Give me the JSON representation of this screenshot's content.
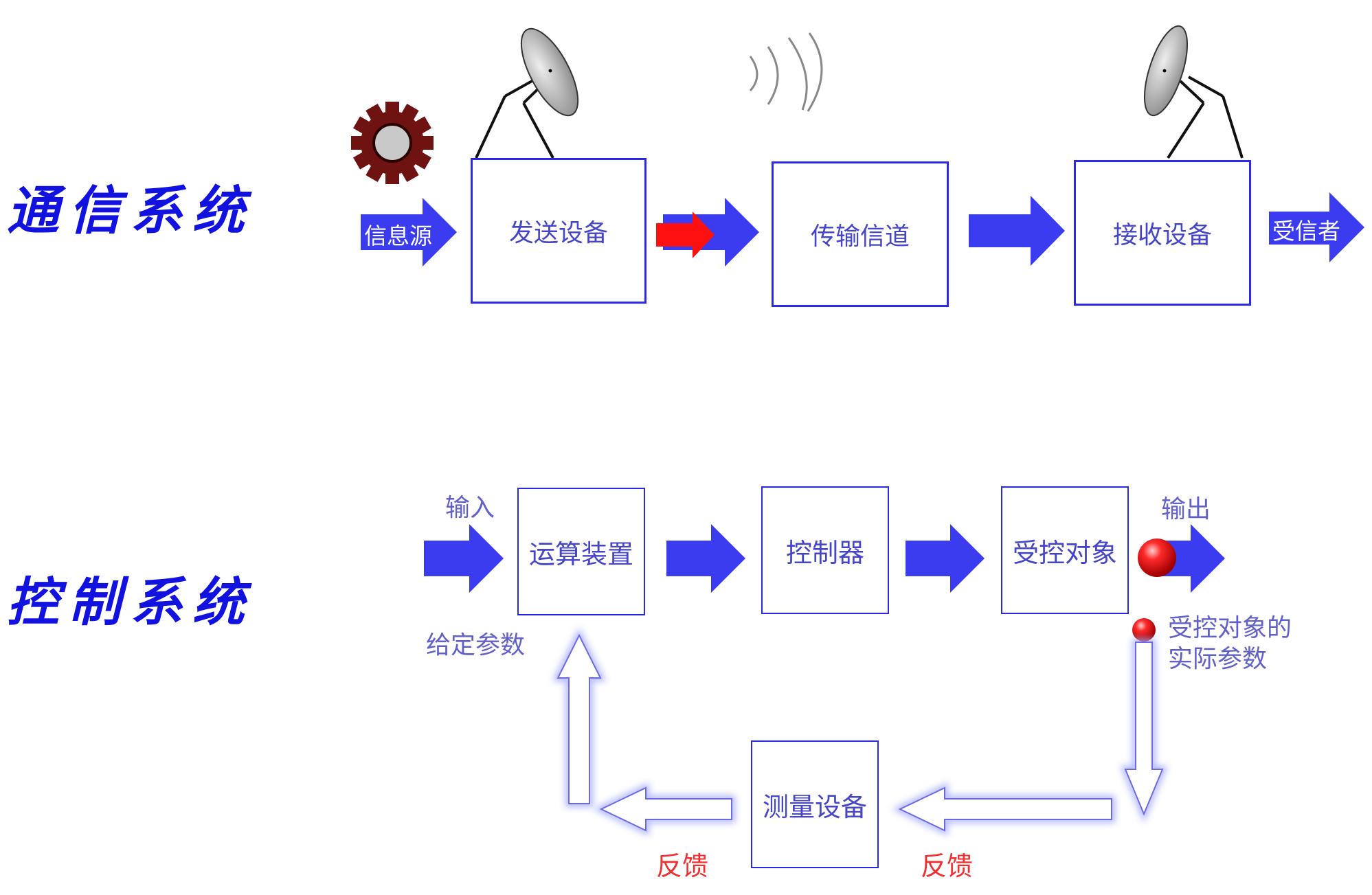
{
  "comm": {
    "title": "通信系统",
    "source": "信息源",
    "transmitter": "发送设备",
    "channel": "传输信道",
    "receiver": "接收设备",
    "sink": "受信者"
  },
  "control": {
    "title": "控制系统",
    "input": "输入",
    "given_params": "给定参数",
    "computing": "运算装置",
    "controller": "控制器",
    "controlled": "受控对象",
    "output": "输出",
    "actual_line1": "受控对象的",
    "actual_line2": "实际参数",
    "measuring": "测量设备",
    "feedback_left": "反馈",
    "feedback_right": "反馈"
  },
  "colors": {
    "arrow_blue": "#3b3bf0",
    "title_blue": "#1212e0",
    "box_border": "#2a2ae6",
    "label_blue": "#6060c8",
    "feedback_red": "#f03030",
    "red_arrow": "#ff1010",
    "gear": "#6e1212"
  },
  "icons": [
    "gear-icon",
    "satellite-dish-icon",
    "radio-wave-icon",
    "red-ball-icon"
  ]
}
